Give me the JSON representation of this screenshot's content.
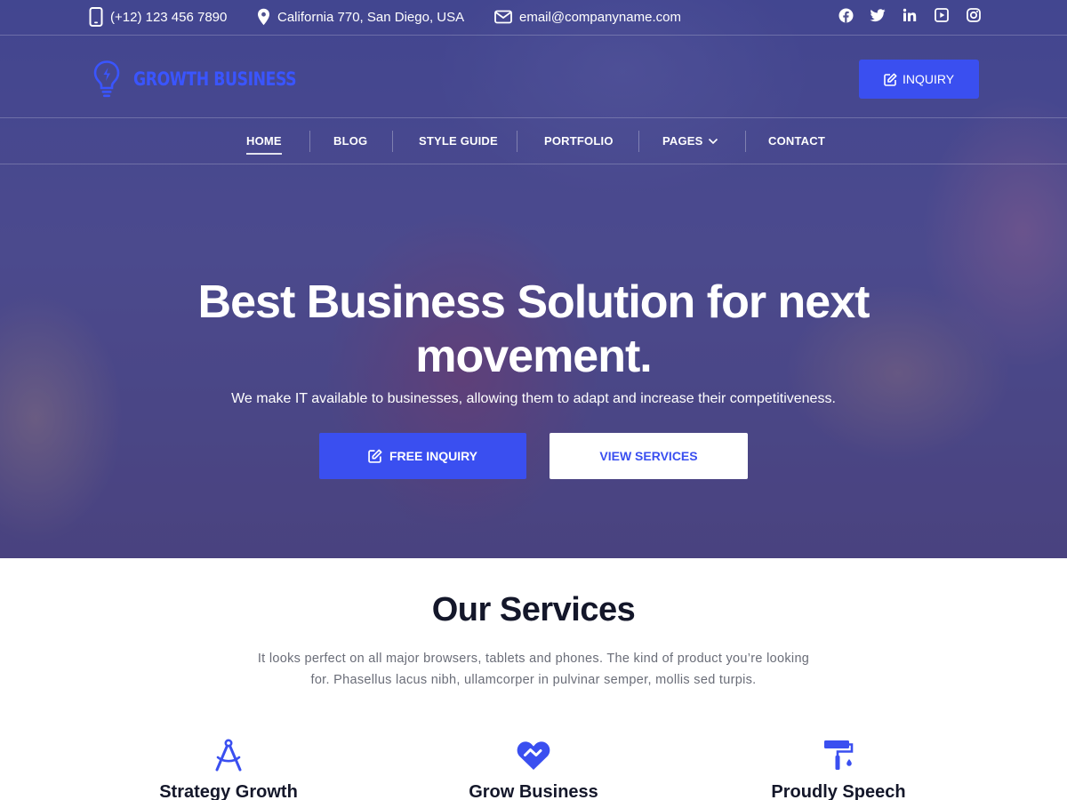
{
  "topbar": {
    "phone": "(+12) 123 456 7890",
    "address": "California 770, San Diego, USA",
    "email": "email@companyname.com",
    "socials": [
      "facebook-icon",
      "twitter-icon",
      "linkedin-icon",
      "youtube-icon",
      "instagram-icon"
    ]
  },
  "header": {
    "logo_text": "GROWTH BUSINESS",
    "inquiry_label": "INQUIRY"
  },
  "nav": {
    "items": [
      {
        "label": "HOME",
        "active": true
      },
      {
        "label": "BLOG"
      },
      {
        "label": "STYLE GUIDE"
      },
      {
        "label": "PORTFOLIO"
      },
      {
        "label": "PAGES",
        "has_dropdown": true
      },
      {
        "label": "CONTACT"
      }
    ]
  },
  "hero": {
    "title_line1": "Best Business Solution for next",
    "title_line2": "movement.",
    "subtitle": "We make IT available to businesses, allowing them to adapt and increase their competitiveness.",
    "primary_button": "FREE INQUIRY",
    "secondary_button": "VIEW SERVICES"
  },
  "services": {
    "title": "Our Services",
    "desc_line1": "It looks perfect on all major browsers, tablets and phones. The kind of product you’re looking",
    "desc_line2": "for. Phasellus lacus nibh, ullamcorper in pulvinar semper, mollis sed turpis.",
    "items": [
      {
        "title": "Strategy Growth",
        "icon": "compass-icon"
      },
      {
        "title": "Grow Business",
        "icon": "handshake-heart-icon"
      },
      {
        "title": "Proudly Speech",
        "icon": "paint-roller-icon"
      }
    ]
  },
  "colors": {
    "accent": "#3a4ff0",
    "heading": "#14172a",
    "body_text": "#6a6d78"
  }
}
